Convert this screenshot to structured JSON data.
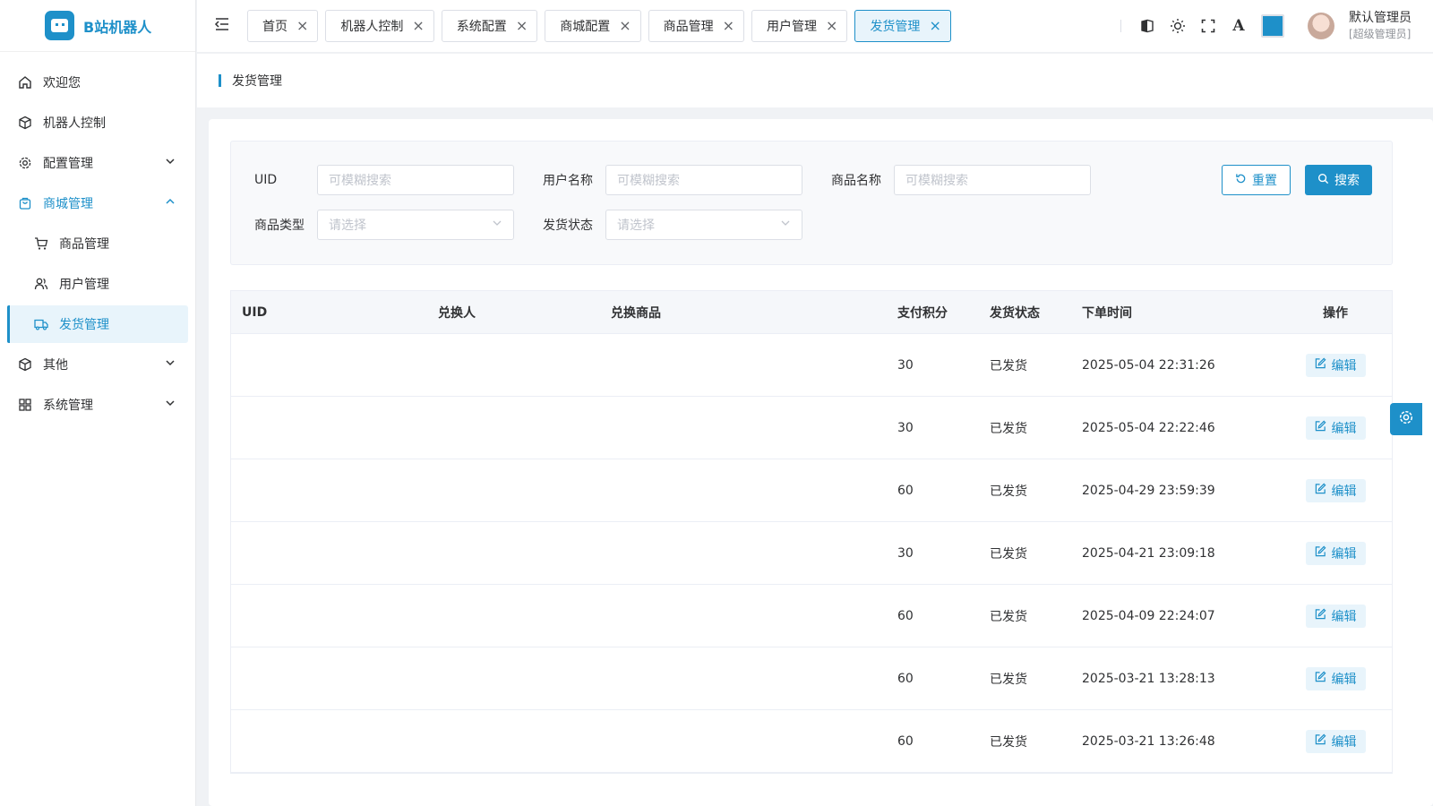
{
  "app": {
    "name": "B站机器人"
  },
  "sidebar": {
    "items": [
      {
        "label": "欢迎您",
        "icon": "home-icon"
      },
      {
        "label": "机器人控制",
        "icon": "cube-icon"
      },
      {
        "label": "配置管理",
        "icon": "gear-icon"
      },
      {
        "label": "商城管理",
        "icon": "shop-icon"
      },
      {
        "label": "商品管理",
        "icon": "cart-icon"
      },
      {
        "label": "用户管理",
        "icon": "users-icon"
      },
      {
        "label": "发货管理",
        "icon": "truck-icon"
      },
      {
        "label": "其他",
        "icon": "box-icon"
      },
      {
        "label": "系统管理",
        "icon": "grid-icon"
      }
    ]
  },
  "tabs": [
    {
      "label": "首页"
    },
    {
      "label": "机器人控制"
    },
    {
      "label": "系统配置"
    },
    {
      "label": "商城配置"
    },
    {
      "label": "商品管理"
    },
    {
      "label": "用户管理"
    },
    {
      "label": "发货管理"
    }
  ],
  "header": {
    "font_label": "A",
    "theme_color": "#1e90c9",
    "user_name": "默认管理员",
    "user_role": "[超级管理员]"
  },
  "breadcrumb": {
    "title": "发货管理"
  },
  "search": {
    "uid_label": "UID",
    "uid_placeholder": "可模糊搜索",
    "username_label": "用户名称",
    "username_placeholder": "可模糊搜索",
    "goods_label": "商品名称",
    "goods_placeholder": "可模糊搜索",
    "type_label": "商品类型",
    "type_placeholder": "请选择",
    "status_label": "发货状态",
    "status_placeholder": "请选择",
    "reset_label": "重置",
    "search_label": "搜索"
  },
  "table": {
    "columns": [
      "UID",
      "兑换人",
      "兑换商品",
      "支付积分",
      "发货状态",
      "下单时间",
      "操作"
    ],
    "edit_label": "编辑",
    "rows": [
      {
        "uid": "",
        "user": "",
        "goods": "",
        "points": "30",
        "status": "已发货",
        "time": "2025-05-04 22:31:26"
      },
      {
        "uid": "",
        "user": "",
        "goods": "",
        "points": "30",
        "status": "已发货",
        "time": "2025-05-04 22:22:46"
      },
      {
        "uid": "",
        "user": "",
        "goods": "",
        "points": "60",
        "status": "已发货",
        "time": "2025-04-29 23:59:39"
      },
      {
        "uid": "",
        "user": "",
        "goods": "",
        "points": "30",
        "status": "已发货",
        "time": "2025-04-21 23:09:18"
      },
      {
        "uid": "",
        "user": "",
        "goods": "",
        "points": "60",
        "status": "已发货",
        "time": "2025-04-09 22:24:07"
      },
      {
        "uid": "",
        "user": "",
        "goods": "",
        "points": "60",
        "status": "已发货",
        "time": "2025-03-21 13:28:13"
      },
      {
        "uid": "",
        "user": "",
        "goods": "",
        "points": "60",
        "status": "已发货",
        "time": "2025-03-21 13:26:48"
      }
    ]
  }
}
